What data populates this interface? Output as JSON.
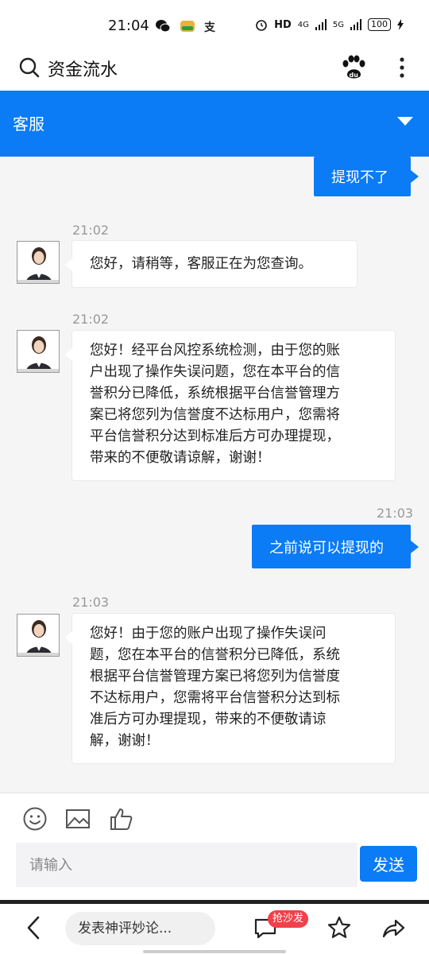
{
  "status_bar": {
    "time": "21:04",
    "app_icons": [
      "wechat-icon",
      "app-icon",
      "alipay-icon"
    ],
    "alipay_glyph": "支",
    "hd": "HD",
    "net1": "4G",
    "net2": "5G",
    "battery": "100"
  },
  "top_nav": {
    "title": "资金流水"
  },
  "header": {
    "label": "客服"
  },
  "messages": [
    {
      "side": "right",
      "text": "提现不了"
    },
    {
      "side": "left",
      "time": "21:02",
      "text": "您好，请稍等，客服正在为您查询。"
    },
    {
      "side": "left",
      "time": "21:02",
      "lines": [
        "您好！经平台风控系统检测，由于您的账",
        "户出现了操作失误问题，您在本平台的信",
        "誉积分已降低，系统根据平台信誉管理方",
        "案已将您列为信誉度不达标用户，您需将",
        "平台信誉积分达到标准后方可办理提现，",
        "带来的不便敬请谅解，谢谢！"
      ]
    },
    {
      "side": "right",
      "time": "21:03",
      "text": "之前说可以提现的"
    },
    {
      "side": "left",
      "time": "21:03",
      "lines": [
        "您好！由于您的账户出现了操作失误问",
        "题，您在本平台的信誉积分已降低，系统",
        "根据平台信誉管理方案已将您列为信誉度",
        "不达标用户，您需将平台信誉积分达到标",
        "准后方可办理提现，带来的不便敬请谅",
        "解，谢谢！"
      ]
    }
  ],
  "input": {
    "placeholder": "请输入",
    "send_label": "发送"
  },
  "bottom_bar": {
    "comment_placeholder": "发表神评妙论...",
    "badge": "抢沙发"
  },
  "colors": {
    "accent": "#0b7bf6",
    "badge": "#f0414a"
  }
}
